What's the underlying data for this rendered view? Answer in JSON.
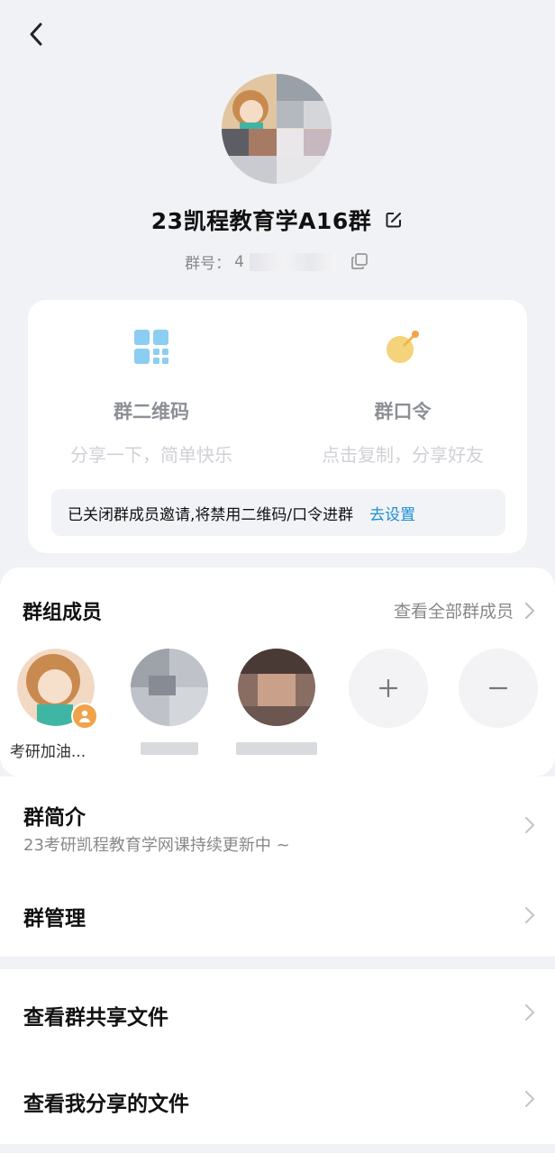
{
  "group": {
    "name": "23凯程教育学A16群",
    "id_label": "群号：",
    "id_visible": "4"
  },
  "share": {
    "qr_label": "群二维码",
    "qr_sub": "分享一下，简单快乐",
    "code_label": "群口令",
    "code_sub": "点击复制，分享好友",
    "notice_text": "已关闭群成员邀请,将禁用二维码/口令进群",
    "notice_link": "去设置"
  },
  "members": {
    "title": "群组成员",
    "view_all": "查看全部群成员",
    "list": [
      {
        "name": "考研加油..."
      },
      {
        "name": ""
      },
      {
        "name": ""
      }
    ],
    "add_symbol": "+",
    "remove_symbol": "−"
  },
  "menu": {
    "intro_title": "群简介",
    "intro_desc": "23考研凯程教育学网课持续更新中 ~",
    "manage": "群管理",
    "shared_files": "查看群共享文件",
    "my_files": "查看我分享的文件"
  },
  "colors": {
    "accent": "#1a8ed8",
    "qr_icon": "#8ccdf2",
    "code_icon": "#f5d37a",
    "owner_badge": "#f0a34a"
  }
}
